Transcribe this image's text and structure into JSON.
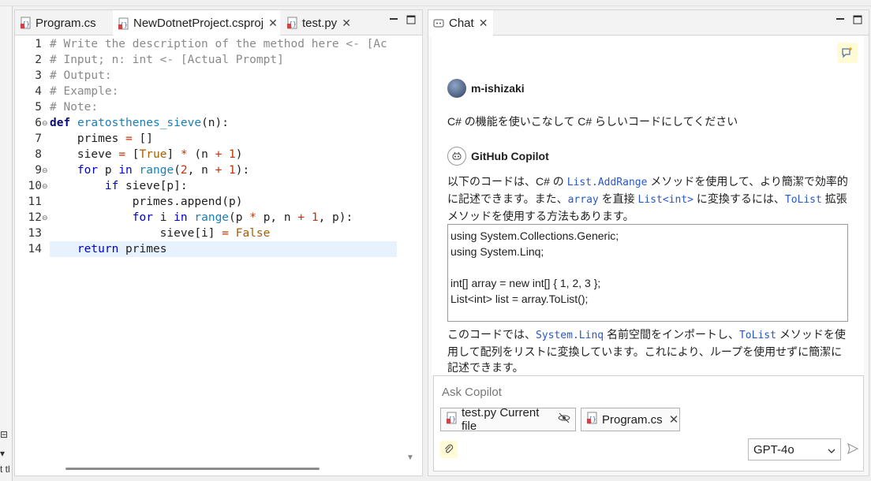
{
  "left_strip": {
    "frag1": "⊟",
    "frag2": "▾",
    "frag3": "t tl"
  },
  "editor": {
    "tabs": [
      {
        "label": "Program.cs"
      },
      {
        "label": "NewDotnetProject.csproj",
        "close": "✕"
      },
      {
        "label": "test.py",
        "close": "✕"
      }
    ],
    "line_numbers": [
      "1",
      "2",
      "3",
      "4",
      "5",
      "6",
      "7",
      "8",
      "9",
      "10",
      "11",
      "12",
      "13",
      "14"
    ],
    "fold_markers": {
      "6": "⊖",
      "9": "⊖",
      "10": "⊖",
      "12": "⊖"
    },
    "lines": [
      "# Write the description of the method here <- [Ac",
      "# Input; n: int <- [Actual Prompt]",
      "# Output:",
      "# Example:",
      "# Note:",
      "def eratosthenes_sieve(n):",
      "    primes = []",
      "    sieve = [True] * (n + 1)",
      "    for p in range(2, n + 1):",
      "        if sieve[p]:",
      "            primes.append(p)",
      "            for i in range(p * p, n + 1, p):",
      "                sieve[i] = False",
      "    return primes"
    ]
  },
  "chat": {
    "tab_label": "Chat",
    "tab_close": "✕",
    "user_name": "m-ishizaki",
    "user_message": "C# の機能を使いこなして C# らしいコードにしてください",
    "bot_name": "GitHub Copilot",
    "reply1": {
      "t1": "以下のコードは、C# の ",
      "c1": "List.AddRange",
      "t2": " メソッドを使用して、より簡潔で効率的に記述できます。また、",
      "c2": "array",
      "t3": " を直接 ",
      "c3": "List<int>",
      "t4": " に変換するには、",
      "c4": "ToList",
      "t5": " 拡張メソッドを使用する方法もあります。"
    },
    "code_lines": [
      "using System.Collections.Generic;",
      "using System.Linq;",
      "",
      "int[] array = new int[] { 1, 2, 3 };",
      "List<int> list = array.ToList();"
    ],
    "reply2": {
      "t1": "このコードでは、",
      "c1": "System.Linq",
      "t2": " 名前空間をインポートし、",
      "c2": "ToList",
      "t3": " メソッドを使用して配列をリストに変換しています。これにより、ループを使用せずに簡潔に記述できます。"
    },
    "input_placeholder": "Ask Copilot",
    "chips": [
      {
        "label": "test.py Current file"
      },
      {
        "label": "Program.cs",
        "close": "✕"
      }
    ],
    "model": "GPT-4o"
  }
}
